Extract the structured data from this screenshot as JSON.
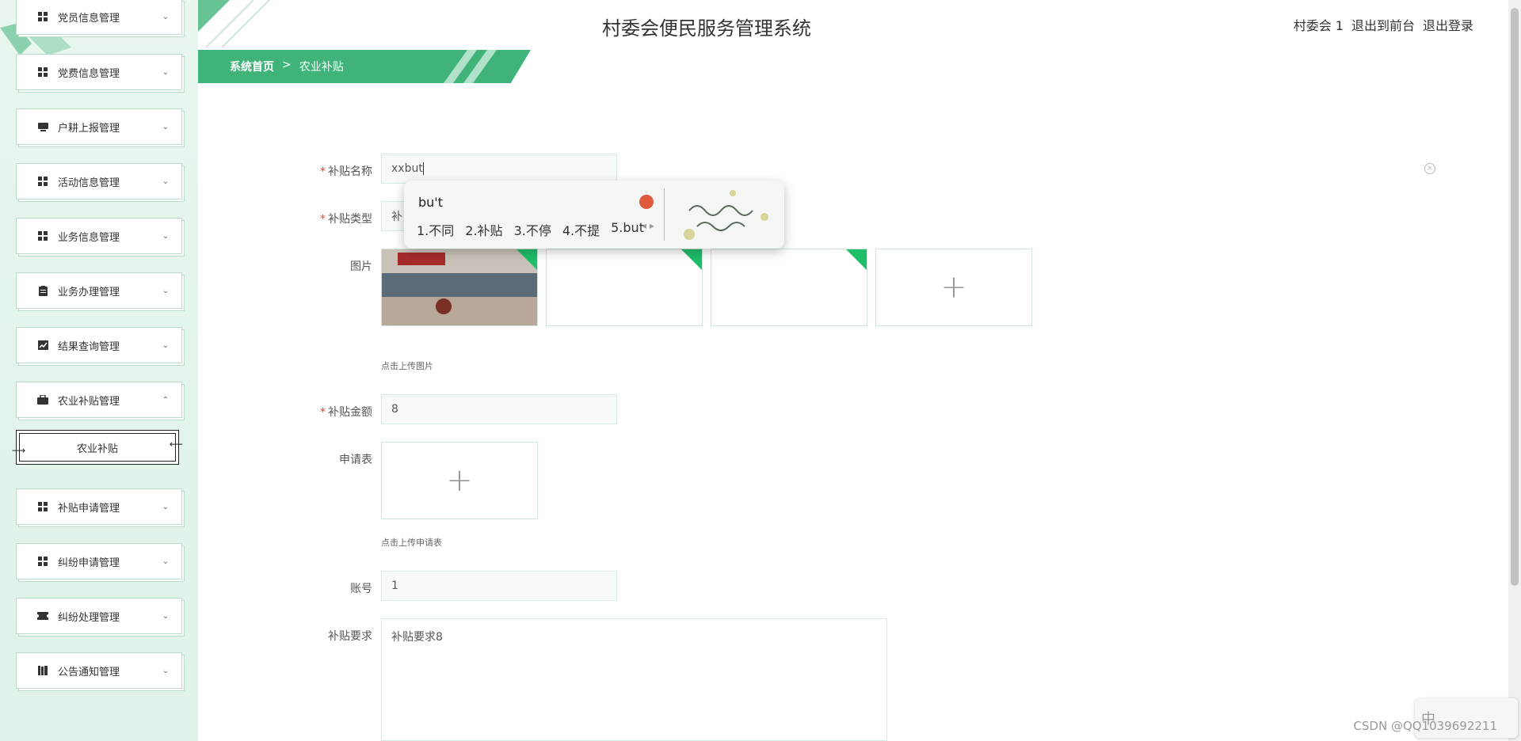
{
  "header": {
    "app_title": "村委会便民服务管理系统",
    "user": "村委会 1",
    "to_frontend": "退出到前台",
    "logout": "退出登录"
  },
  "breadcrumb": {
    "home": "系统首页",
    "separator": ">",
    "current": "农业补贴"
  },
  "sidebar": {
    "items": [
      {
        "label": "党员信息管理",
        "icon": "grid-icon",
        "chevron": "⌄"
      },
      {
        "label": "党费信息管理",
        "icon": "grid-icon",
        "chevron": "⌄"
      },
      {
        "label": "户耕上报管理",
        "icon": "tablet-icon",
        "chevron": "⌄"
      },
      {
        "label": "活动信息管理",
        "icon": "grid-icon",
        "chevron": "⌄"
      },
      {
        "label": "业务信息管理",
        "icon": "grid-icon",
        "chevron": "⌄"
      },
      {
        "label": "业务办理管理",
        "icon": "clipboard-icon",
        "chevron": "⌄"
      },
      {
        "label": "结果查询管理",
        "icon": "chart-icon",
        "chevron": "⌄"
      },
      {
        "label": "农业补贴管理",
        "icon": "briefcase-icon",
        "chevron": "⌃"
      },
      {
        "label": "补贴申请管理",
        "icon": "grid-icon",
        "chevron": "⌄"
      },
      {
        "label": "纠纷申请管理",
        "icon": "grid-icon",
        "chevron": "⌄"
      },
      {
        "label": "纠纷处理管理",
        "icon": "ticket-icon",
        "chevron": "⌄"
      },
      {
        "label": "公告通知管理",
        "icon": "books-icon",
        "chevron": "⌄"
      }
    ],
    "submenu": {
      "label": "农业补贴"
    }
  },
  "form": {
    "subsidy_name": {
      "label": "补贴名称",
      "required": "*",
      "value": "xxbut"
    },
    "subsidy_type": {
      "label": "补贴类型",
      "required": "*",
      "value": "补"
    },
    "image": {
      "label": "图片",
      "hint": "点击上传图片"
    },
    "amount": {
      "label": "补贴金额",
      "required": "*",
      "value": "8"
    },
    "application": {
      "label": "申请表",
      "hint": "点击上传申请表"
    },
    "account": {
      "label": "账号",
      "value": "1"
    },
    "requirement": {
      "label": "补贴要求",
      "value": "补贴要求8"
    }
  },
  "ime": {
    "composition": "bu't",
    "candidates": [
      "1.不同",
      "2.补贴",
      "3.不停",
      "4.不提",
      "5.but"
    ]
  },
  "ime_tray": {
    "label": "中"
  },
  "watermark": "CSDN @QQ1039692211",
  "colors": {
    "accent": "#3fb37a",
    "corner": "#1fbf6a",
    "required": "#e6433d"
  }
}
